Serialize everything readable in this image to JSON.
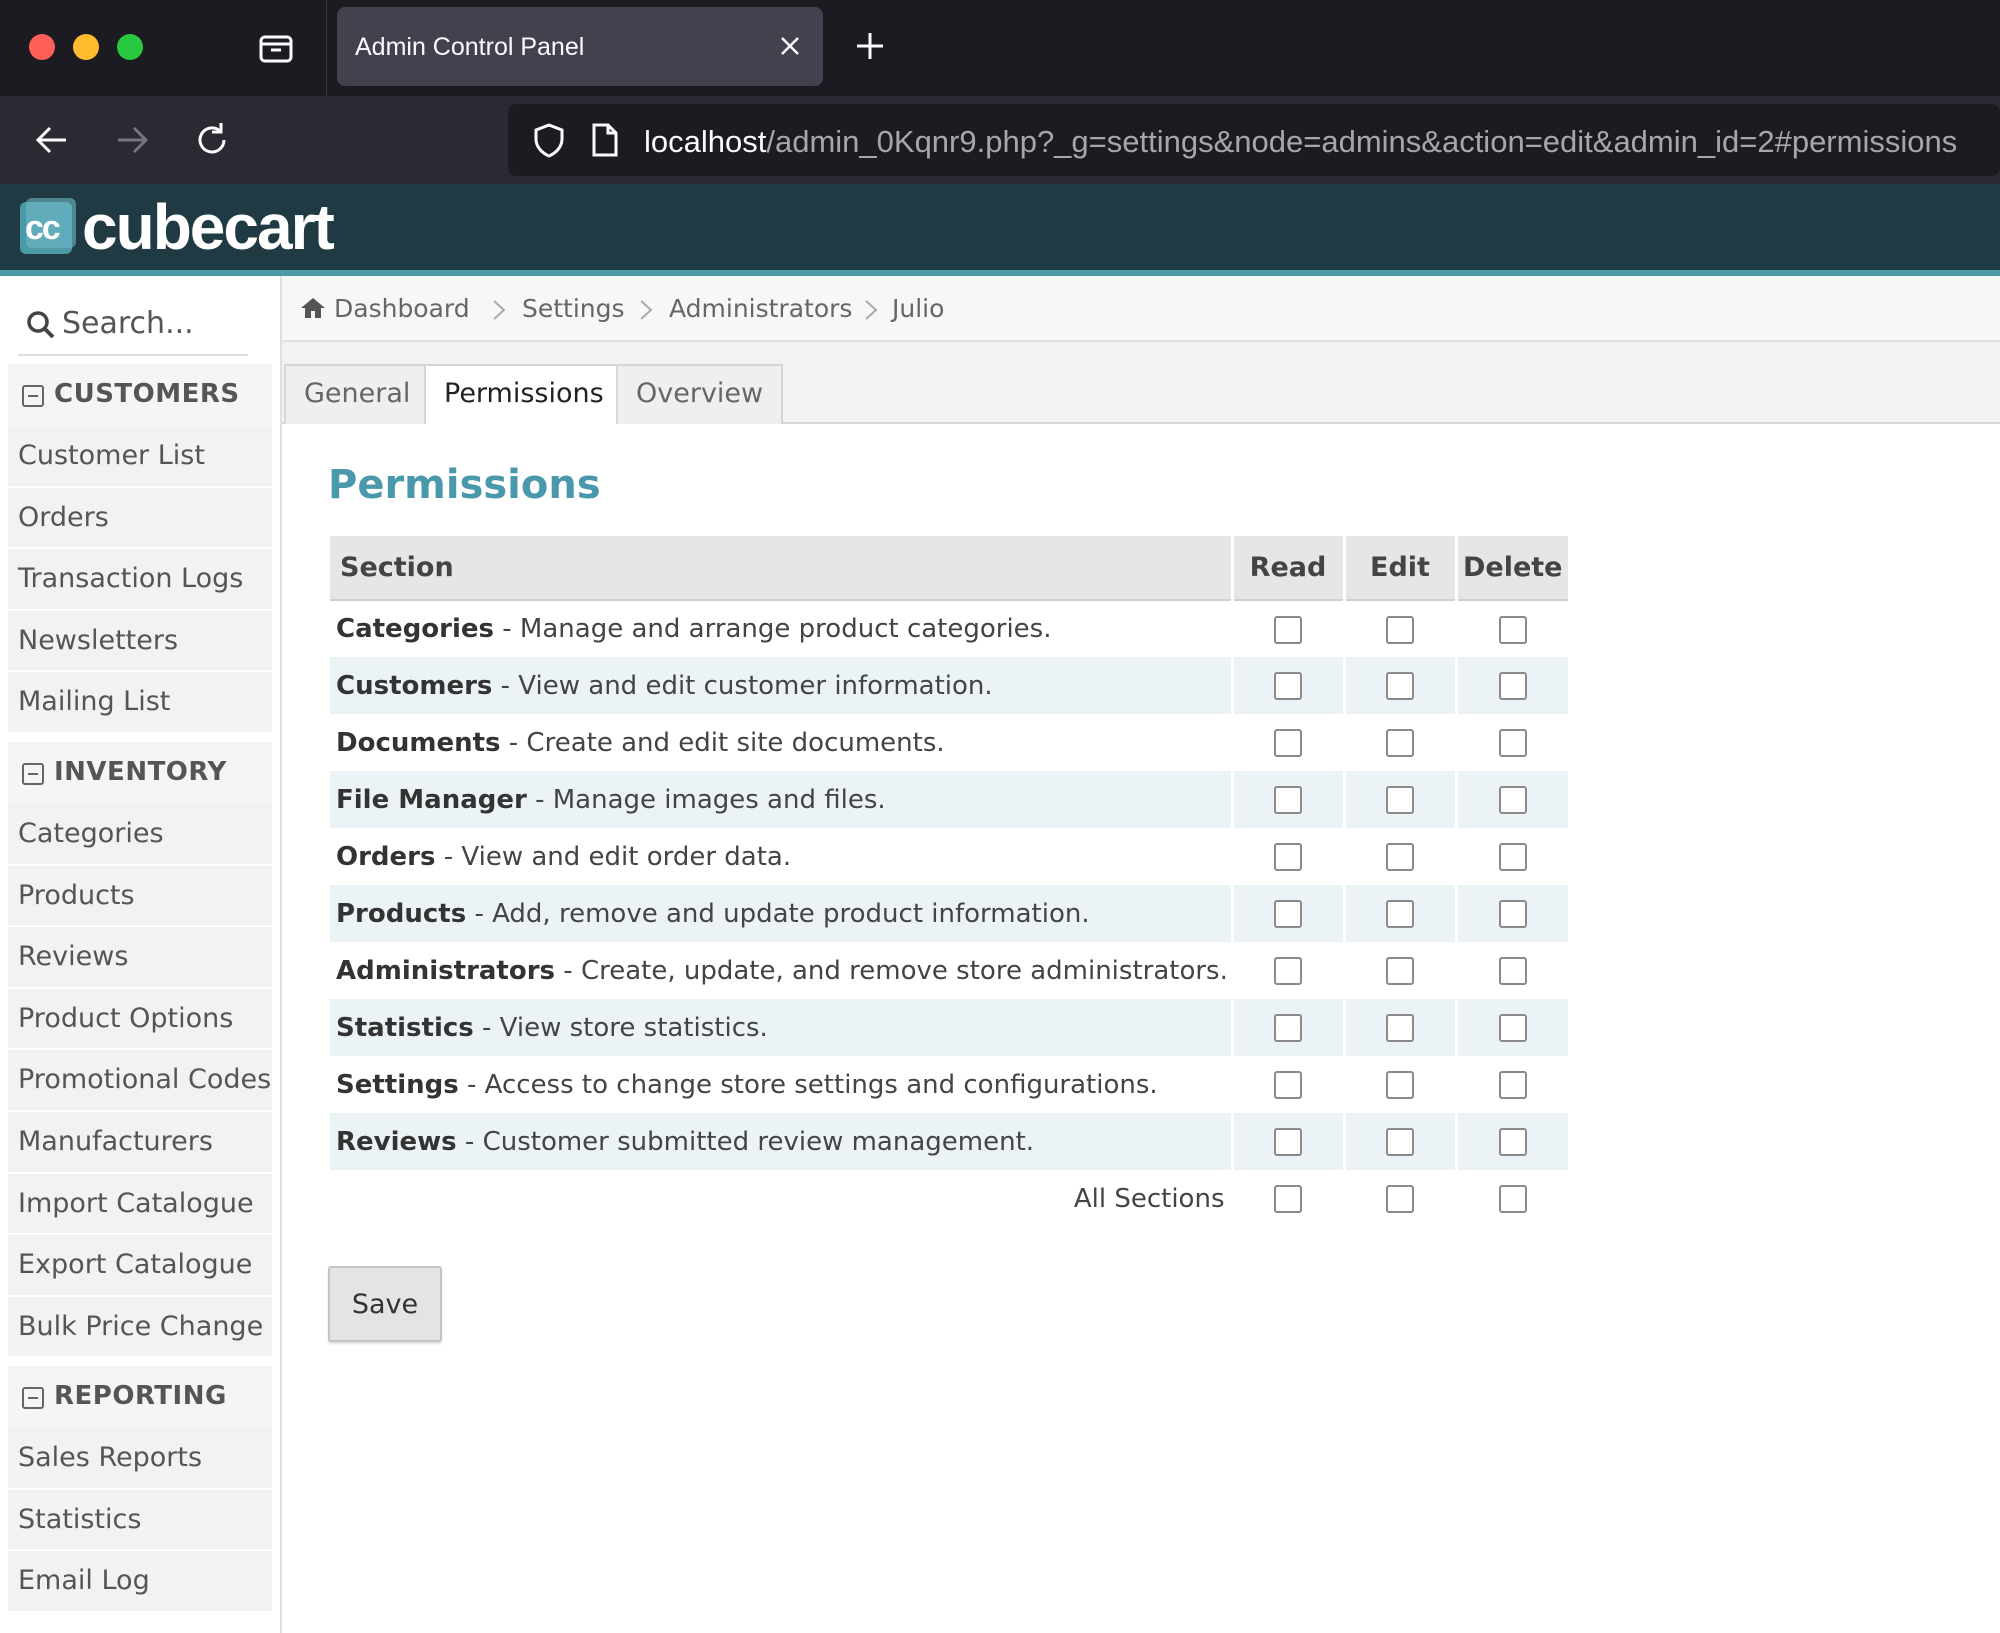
{
  "browser": {
    "tab_title": "Admin Control Panel",
    "url_host": "localhost",
    "url_path": "/admin_0Kqnr9.php?_g=settings&node=admins&action=edit&admin_id=2#permissions"
  },
  "app": {
    "logo_text": "cubecart",
    "logo_mark": "cc"
  },
  "sidebar": {
    "search_placeholder": "Search...",
    "sections": [
      {
        "title": "CUSTOMERS",
        "items": [
          {
            "label": "Customer List"
          },
          {
            "label": "Orders"
          },
          {
            "label": "Transaction Logs"
          },
          {
            "label": "Newsletters"
          },
          {
            "label": "Mailing List"
          }
        ]
      },
      {
        "title": "INVENTORY",
        "items": [
          {
            "label": "Categories"
          },
          {
            "label": "Products"
          },
          {
            "label": "Reviews"
          },
          {
            "label": "Product Options"
          },
          {
            "label": "Promotional Codes"
          },
          {
            "label": "Manufacturers"
          },
          {
            "label": "Import Catalogue"
          },
          {
            "label": "Export Catalogue"
          },
          {
            "label": "Bulk Price Change"
          }
        ]
      },
      {
        "title": "REPORTING",
        "items": [
          {
            "label": "Sales Reports"
          },
          {
            "label": "Statistics"
          },
          {
            "label": "Email Log"
          }
        ]
      }
    ]
  },
  "breadcrumb": [
    "Dashboard",
    "Settings",
    "Administrators",
    "Julio"
  ],
  "tabs": [
    {
      "label": "General",
      "active": false
    },
    {
      "label": "Permissions",
      "active": true
    },
    {
      "label": "Overview",
      "active": false
    }
  ],
  "permissions": {
    "title": "Permissions",
    "columns": {
      "section": "Section",
      "read": "Read",
      "edit": "Edit",
      "delete": "Delete"
    },
    "rows": [
      {
        "name": "Categories",
        "desc": " - Manage and arrange product categories."
      },
      {
        "name": "Customers",
        "desc": " - View and edit customer information."
      },
      {
        "name": "Documents",
        "desc": " - Create and edit site documents."
      },
      {
        "name": "File Manager",
        "desc": " - Manage images and files."
      },
      {
        "name": "Orders",
        "desc": " - View and edit order data."
      },
      {
        "name": "Products",
        "desc": " - Add, remove and update product information."
      },
      {
        "name": "Administrators",
        "desc": " - Create, update, and remove store administrators."
      },
      {
        "name": "Statistics",
        "desc": " - View store statistics."
      },
      {
        "name": "Settings",
        "desc": " - Access to change store settings and configurations."
      },
      {
        "name": "Reviews",
        "desc": " - Customer submitted review management."
      }
    ],
    "all_sections_label": "All Sections",
    "save_label": "Save"
  },
  "colors": {
    "header_bg": "#1f3a42",
    "header_accent": "#4b9aa8",
    "title_color": "#4a98ab",
    "row_alt": "#ebf3f7"
  }
}
